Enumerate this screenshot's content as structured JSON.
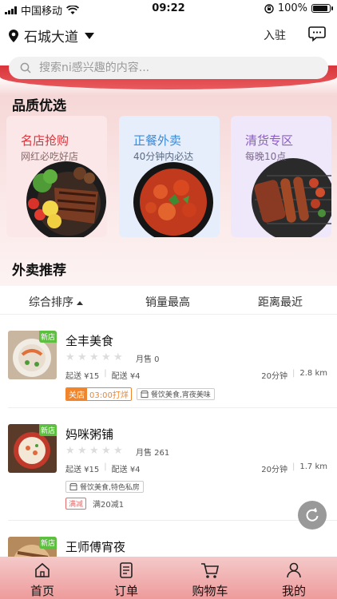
{
  "status_bar": {
    "carrier": "中国移动",
    "time": "09:22",
    "battery": "100%",
    "battery_level": 1.0
  },
  "header": {
    "location": "石城大道",
    "join_label": "入驻"
  },
  "search": {
    "placeholder": "搜索ni感兴趣的内容..."
  },
  "quality": {
    "title": "品质优选",
    "cards": [
      {
        "title": "名店抢购",
        "sub": "网红必吃好店",
        "title_color": "#d9363e",
        "sub_color": "#8a6a6a",
        "bg": "#fbe7e8"
      },
      {
        "title": "正餐外卖",
        "sub": "40分钟内必达",
        "title_color": "#3b8ad9",
        "sub_color": "#5b6b82",
        "bg": "#e6eefb"
      },
      {
        "title": "清货专区",
        "sub": "每晚10点",
        "title_color": "#8b5cc7",
        "sub_color": "#7b6a8e",
        "bg": "#efe7fa"
      }
    ]
  },
  "takeout": {
    "title": "外卖推荐",
    "sort_options": [
      "综合排序",
      "销量最高",
      "距离最近"
    ]
  },
  "shops": [
    {
      "name": "全丰美食",
      "badge": "新店",
      "sales": "月售 0",
      "start_fee": "起送 ¥15",
      "delivery_fee": "配送 ¥4",
      "time": "20分钟",
      "distance": "2.8 km",
      "status_label": "关店",
      "status_time": "03:00打烊",
      "category": "餐饮美食,宵夜美味",
      "rating": 0
    },
    {
      "name": "妈咪粥铺",
      "badge": "新店",
      "sales": "月售 261",
      "start_fee": "起送 ¥15",
      "delivery_fee": "配送 ¥4",
      "time": "20分钟",
      "distance": "1.7 km",
      "category": "餐饮美食,特色私房",
      "promo_tag": "满减",
      "promo_text": "满20减1",
      "rating": 0
    },
    {
      "name": "王师傅宵夜",
      "badge": "新店"
    }
  ],
  "tabs": [
    {
      "label": "首页",
      "icon": "home-icon"
    },
    {
      "label": "订单",
      "icon": "order-icon"
    },
    {
      "label": "购物车",
      "icon": "cart-icon"
    },
    {
      "label": "我的",
      "icon": "user-icon"
    }
  ]
}
